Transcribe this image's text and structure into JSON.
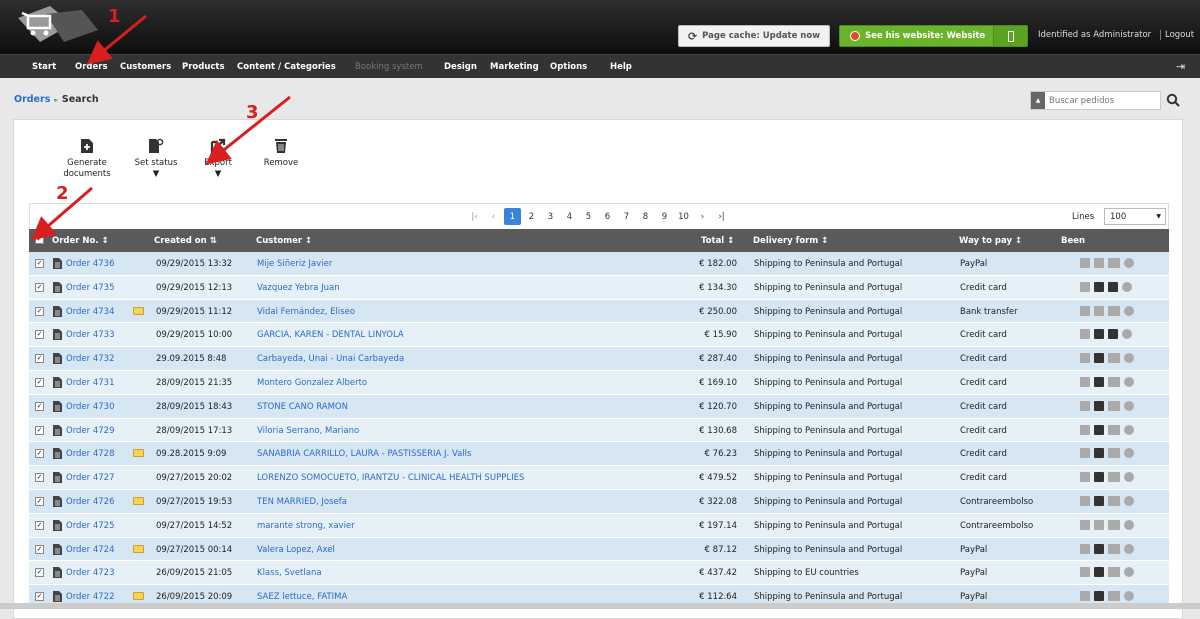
{
  "header": {
    "cache_button": "Page cache: Update now",
    "website_button": "See his website: Website",
    "identity": "Identified as Administrator",
    "logout": "Logout"
  },
  "nav": [
    {
      "label": "Start"
    },
    {
      "label": "Orders"
    },
    {
      "label": "Customers"
    },
    {
      "label": "Products"
    },
    {
      "label": "Content / Categories"
    },
    {
      "label": "Booking system"
    },
    {
      "label": "Design"
    },
    {
      "label": "Marketing"
    },
    {
      "label": "Options"
    },
    {
      "label": "Help"
    }
  ],
  "breadcrumb": {
    "parent": "Orders",
    "current": "Search"
  },
  "search": {
    "placeholder": "Buscar pedidos"
  },
  "toolbar": {
    "generate_1": "Generate",
    "generate_2": "documents",
    "set_status": "Set status",
    "export": "Export",
    "remove": "Remove"
  },
  "pager": {
    "pages": [
      "1",
      "2",
      "3",
      "4",
      "5",
      "6",
      "7",
      "8",
      "9",
      "10"
    ],
    "active": "1",
    "lines_label": "Lines",
    "lines_value": "100"
  },
  "columns": {
    "order_no": "Order No.",
    "created_on": "Created on",
    "customer": "Customer",
    "total": "Total",
    "delivery": "Delivery form",
    "pay": "Way to pay",
    "been": "Been"
  },
  "orders": [
    {
      "order": "Order 4736",
      "date": "09/29/2015 13:32",
      "customer": "Mije Siñeriz Javier",
      "total": "€ 182.00",
      "delivery": "Shipping to Peninsula and Portugal",
      "pay": "PayPal",
      "note": false,
      "inv": "g",
      "flag": false
    },
    {
      "order": "Order 4735",
      "date": "09/29/2015 12:13",
      "customer": "Vazquez Yebra Juan",
      "total": "€ 134.30",
      "delivery": "Shipping to Peninsula and Portugal",
      "pay": "Credit card",
      "note": false,
      "inv": "d",
      "flag": true
    },
    {
      "order": "Order 4734",
      "date": "09/29/2015 11:12",
      "customer": "Vidal Fernández, Eliseo",
      "total": "€ 250.00",
      "delivery": "Shipping to Peninsula and Portugal",
      "pay": "Bank transfer",
      "note": true,
      "inv": "g",
      "flag": false
    },
    {
      "order": "Order 4733",
      "date": "09/29/2015 10:00",
      "customer": "GARCIA, KAREN - DENTAL LINYOLA",
      "total": "€ 15.90",
      "delivery": "Shipping to Peninsula and Portugal",
      "pay": "Credit card",
      "note": false,
      "inv": "d",
      "flag": true
    },
    {
      "order": "Order 4732",
      "date": "29.09.2015 8:48",
      "customer": "Carbayeda, Unai - Unai Carbayeda",
      "total": "€ 287.40",
      "delivery": "Shipping to Peninsula and Portugal",
      "pay": "Credit card",
      "note": false,
      "inv": "d",
      "flag": false
    },
    {
      "order": "Order 4731",
      "date": "28/09/2015 21:35",
      "customer": "Montero Gonzalez Alberto",
      "total": "€ 169.10",
      "delivery": "Shipping to Peninsula and Portugal",
      "pay": "Credit card",
      "note": false,
      "inv": "d",
      "flag": false
    },
    {
      "order": "Order 4730",
      "date": "28/09/2015 18:43",
      "customer": "STONE CANO RAMON",
      "total": "€ 120.70",
      "delivery": "Shipping to Peninsula and Portugal",
      "pay": "Credit card",
      "note": false,
      "inv": "d",
      "flag": false
    },
    {
      "order": "Order 4729",
      "date": "28/09/2015 17:13",
      "customer": "Viloria Serrano, Mariano",
      "total": "€ 130.68",
      "delivery": "Shipping to Peninsula and Portugal",
      "pay": "Credit card",
      "note": false,
      "inv": "d",
      "flag": false
    },
    {
      "order": "Order 4728",
      "date": "09.28.2015 9:09",
      "customer": "SANABRIA CARRILLO, LAURA - PASTISSERIA J. Valls",
      "total": "€ 76.23",
      "delivery": "Shipping to Peninsula and Portugal",
      "pay": "Credit card",
      "note": true,
      "inv": "d",
      "flag": false
    },
    {
      "order": "Order 4727",
      "date": "09/27/2015 20:02",
      "customer": "LORENZO SOMOCUETO, IRANTZU - CLINICAL HEALTH SUPPLIES",
      "total": "€ 479.52",
      "delivery": "Shipping to Peninsula and Portugal",
      "pay": "Credit card",
      "note": false,
      "inv": "d",
      "flag": false
    },
    {
      "order": "Order 4726",
      "date": "09/27/2015 19:53",
      "customer": "TEN MARRIED, Josefa",
      "total": "€ 322.08",
      "delivery": "Shipping to Peninsula and Portugal",
      "pay": "Contrareembolso",
      "note": true,
      "inv": "d",
      "flag": false
    },
    {
      "order": "Order 4725",
      "date": "09/27/2015 14:52",
      "customer": "marante strong, xavier",
      "total": "€ 197.14",
      "delivery": "Shipping to Peninsula and Portugal",
      "pay": "Contrareembolso",
      "note": false,
      "inv": "g",
      "flag": false
    },
    {
      "order": "Order 4724",
      "date": "09/27/2015 00:14",
      "customer": "Valera Lopez, Axel",
      "total": "€ 87.12",
      "delivery": "Shipping to Peninsula and Portugal",
      "pay": "PayPal",
      "note": true,
      "inv": "d",
      "flag": false
    },
    {
      "order": "Order 4723",
      "date": "26/09/2015 21:05",
      "customer": "Klass, Svetlana",
      "total": "€ 437.42",
      "delivery": "Shipping to EU countries",
      "pay": "PayPal",
      "note": false,
      "inv": "d",
      "flag": false
    },
    {
      "order": "Order 4722",
      "date": "26/09/2015 20:09",
      "customer": "SAEZ lettuce, FATIMA",
      "total": "€ 112.64",
      "delivery": "Shipping to Peninsula and Portugal",
      "pay": "PayPal",
      "note": true,
      "inv": "d",
      "flag": false
    }
  ],
  "annotations": [
    "1",
    "2",
    "3"
  ],
  "colors": {
    "accent": "#2a6bc8",
    "green": "#6ab42c",
    "arrow": "#d81e1e"
  }
}
